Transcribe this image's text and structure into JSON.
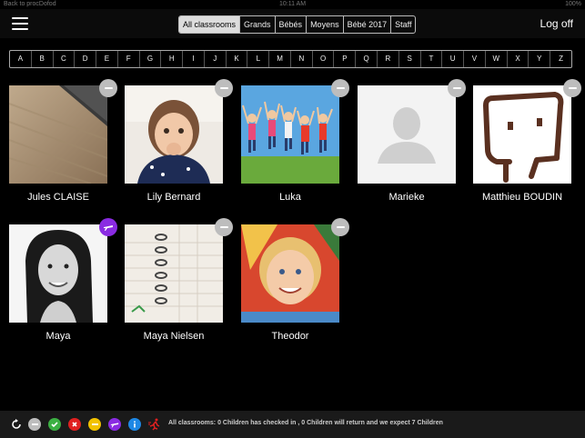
{
  "statusbar": {
    "back": "Back to procDofod",
    "time": "10:11 AM",
    "battery": "100%"
  },
  "nav": {
    "tabs": [
      {
        "label": "All classrooms",
        "active": true
      },
      {
        "label": "Grands",
        "active": false
      },
      {
        "label": "Bébés",
        "active": false
      },
      {
        "label": "Moyens",
        "active": false
      },
      {
        "label": "Bébé 2017",
        "active": false
      },
      {
        "label": "Staff",
        "active": false
      }
    ],
    "logoff": "Log off"
  },
  "alphabet": [
    "A",
    "B",
    "C",
    "D",
    "E",
    "F",
    "G",
    "H",
    "I",
    "J",
    "K",
    "L",
    "M",
    "N",
    "O",
    "P",
    "Q",
    "R",
    "S",
    "T",
    "U",
    "V",
    "W",
    "X",
    "Y",
    "Z"
  ],
  "children": [
    {
      "name": "Jules CLAISE",
      "badge": "minus",
      "photo": "wood-table"
    },
    {
      "name": "Lily Bernard",
      "badge": "minus",
      "photo": "child-girl"
    },
    {
      "name": "Luka",
      "badge": "minus",
      "photo": "kids-jumping"
    },
    {
      "name": "Marieke",
      "badge": "minus",
      "photo": "placeholder-avatar"
    },
    {
      "name": "Matthieu BOUDIN",
      "badge": "minus",
      "photo": "drawing-face"
    },
    {
      "name": "Maya",
      "badge": "plane",
      "photo": "girl-bw"
    },
    {
      "name": "Maya Nielsen",
      "badge": "minus",
      "photo": "notebook"
    },
    {
      "name": "Theodor",
      "badge": "minus",
      "photo": "blond-boy"
    }
  ],
  "bottombar": {
    "summary": "All classrooms: 0 Children has checked in , 0 Children will return and we expect 7 Children",
    "icons": [
      "refresh-icon",
      "absent-icon",
      "checked-in-icon",
      "cancel-icon",
      "pending-icon",
      "vacation-icon",
      "info-icon",
      "runner-icon"
    ]
  },
  "colors": {
    "accent_purple": "#8a2be2",
    "green": "#3cb043",
    "red": "#e02020",
    "yellow": "#f2c200",
    "blue": "#1e88e5"
  }
}
